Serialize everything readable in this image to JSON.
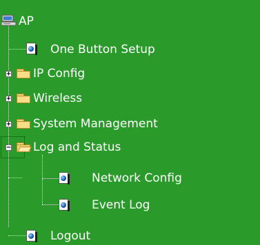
{
  "tree": {
    "root": {
      "label": "AP",
      "icon": "computer-icon"
    },
    "items": [
      {
        "label": "One Button Setup",
        "icon": "page-icon"
      },
      {
        "label": "IP Config",
        "icon": "folder-icon",
        "expander": "+"
      },
      {
        "label": "Wireless",
        "icon": "folder-icon",
        "expander": "+"
      },
      {
        "label": "System Management",
        "icon": "folder-icon",
        "expander": "+"
      },
      {
        "label": "Log and Status",
        "icon": "folder-open-icon",
        "expander": "−",
        "children": [
          {
            "label": "Network Config",
            "icon": "page-icon"
          },
          {
            "label": "Event Log",
            "icon": "page-icon"
          }
        ]
      },
      {
        "label": "Logout",
        "icon": "page-icon"
      }
    ]
  },
  "colors": {
    "background": "#2a9a2a",
    "text": "#ffffff"
  }
}
